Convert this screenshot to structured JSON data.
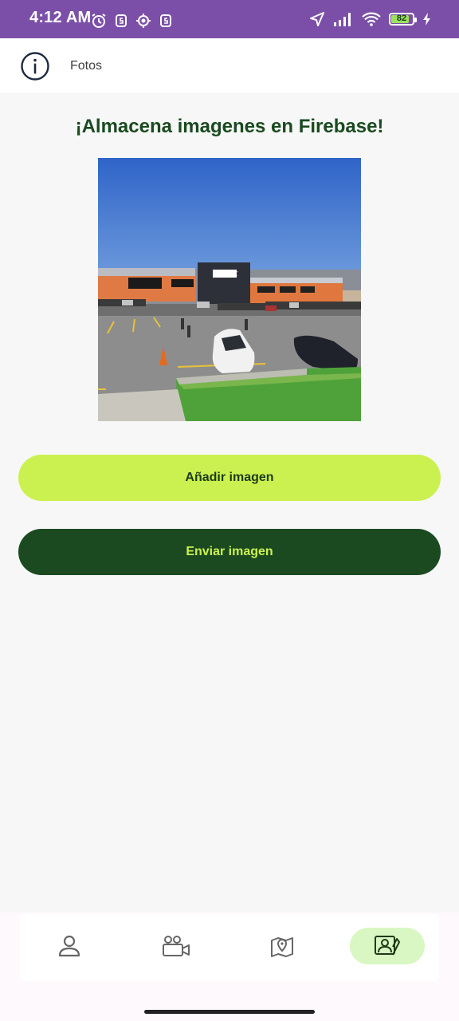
{
  "status_bar": {
    "time": "4:12 AM",
    "battery_level": "82",
    "icons_left": [
      "alarm-icon",
      "app-s-icon",
      "location-target-icon",
      "app-s-icon"
    ],
    "icons_right": [
      "navigation-arrow-icon",
      "signal-icon",
      "wifi-icon",
      "battery-icon",
      "charging-bolt-icon"
    ]
  },
  "header": {
    "title": "Fotos",
    "info_icon": "info-icon"
  },
  "main": {
    "title": "¡Almacena imagenes en Firebase!",
    "photo": {
      "sign_text": "outlet"
    },
    "add_button_label": "Añadir imagen",
    "send_button_label": "Enviar imagen"
  },
  "bottom_nav": {
    "items": [
      {
        "icon": "person-icon",
        "active": false
      },
      {
        "icon": "video-camera-icon",
        "active": false
      },
      {
        "icon": "map-pin-icon",
        "active": false
      },
      {
        "icon": "photo-id-icon",
        "active": true
      }
    ]
  },
  "colors": {
    "status_bar": "#7b4fa8",
    "title_green": "#1a4a1f",
    "lime": "#cbf150",
    "dark_green": "#1b4a21",
    "active_nav": "#d8f7c2"
  }
}
